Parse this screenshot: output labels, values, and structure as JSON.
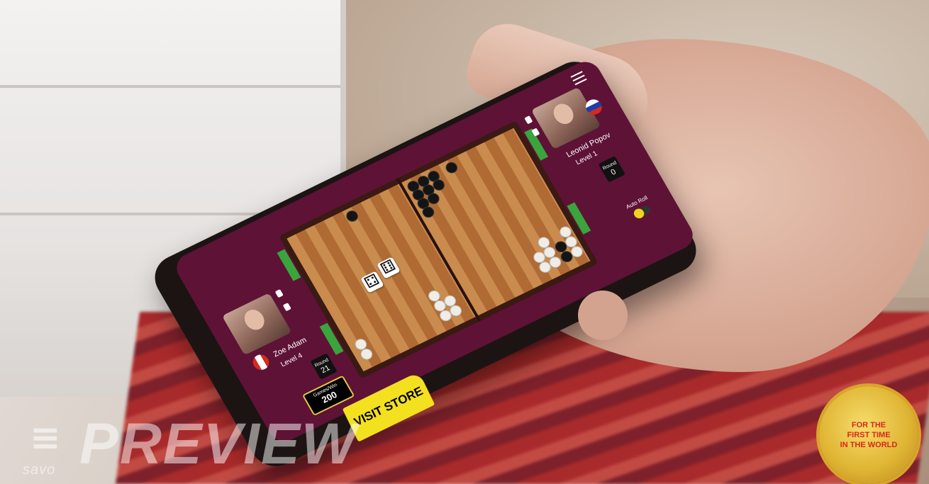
{
  "players": {
    "left": {
      "name": "Zoe Adam",
      "level": "Level 4",
      "timer_label": "Round",
      "timer_value": "21",
      "flag": "canada"
    },
    "right": {
      "name": "Leonid Popov",
      "level": "Level 1",
      "timer_label": "Round",
      "timer_value": "0",
      "flag": "russia"
    }
  },
  "stake": {
    "label": "Games/Win",
    "value": "200"
  },
  "auto_roll": {
    "label": "Auto Roll"
  },
  "dice": [
    "⚃",
    "⚅"
  ],
  "visit_store": "VISIT STORE",
  "watermark": {
    "brand": "savo",
    "preview": "PREVIEW"
  },
  "seal": {
    "line1": "FOR THE",
    "line2": "FIRST TIME",
    "line3": "IN THE WORLD"
  },
  "colors": {
    "screen_bg": "#5e1236",
    "board_light": "#c98b4e",
    "board_dark": "#b06b34",
    "accent_green": "#39a53c",
    "store_yellow": "#f3e01f"
  }
}
